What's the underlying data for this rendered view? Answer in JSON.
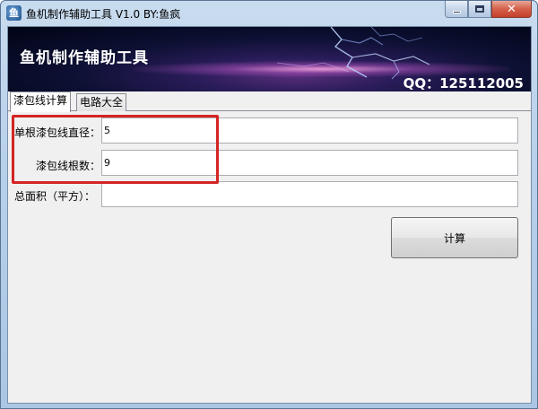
{
  "window": {
    "title": "鱼机制作辅助工具 V1.0  BY:鱼疯",
    "icon": "app-fish-icon"
  },
  "banner": {
    "title": "鱼机制作辅助工具",
    "qq": "QQ：125112005"
  },
  "tabs": [
    {
      "label": "漆包线计算",
      "active": true
    },
    {
      "label": "电路大全",
      "active": false
    }
  ],
  "form": {
    "diameter_label": "单根漆包线直径：",
    "diameter_value": "5",
    "count_label": "漆包线根数：",
    "count_value": "9",
    "area_label": "总面积（平方）：",
    "area_value": ""
  },
  "actions": {
    "calculate_label": "计算"
  },
  "colors": {
    "highlight": "#d42424",
    "close_button": "#c2412b",
    "banner_dark": "#000414"
  }
}
